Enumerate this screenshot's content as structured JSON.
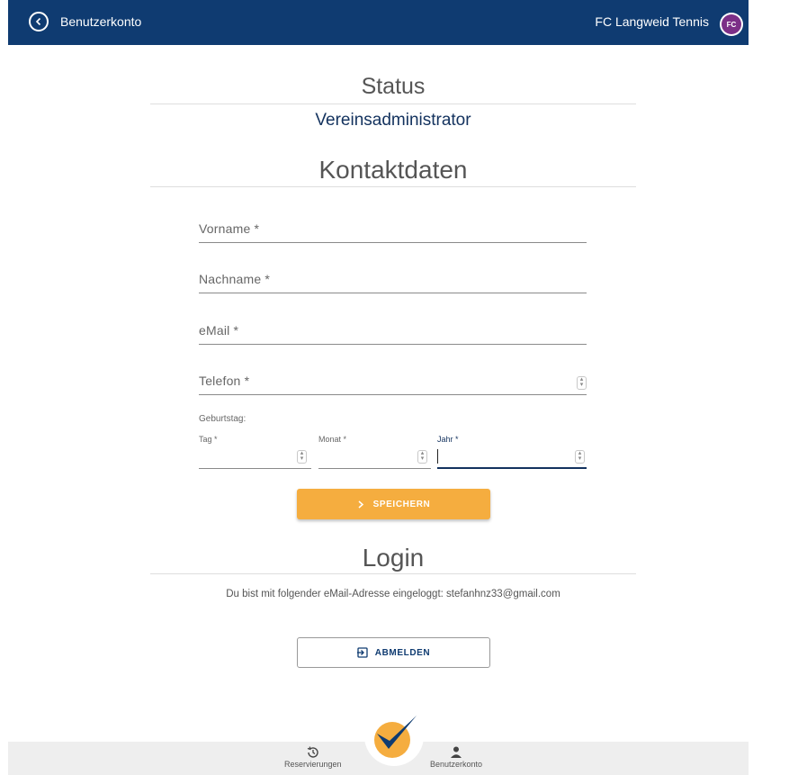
{
  "header": {
    "title": "Benutzerkonto",
    "club_name": "FC Langweid Tennis",
    "logo_text": "FC"
  },
  "status": {
    "heading": "Status",
    "value": "Vereinsadministrator"
  },
  "contact": {
    "heading": "Kontaktdaten",
    "fields": {
      "first_name": {
        "label": "Vorname *",
        "value": ""
      },
      "last_name": {
        "label": "Nachname *",
        "value": ""
      },
      "email": {
        "label": "eMail *",
        "value": ""
      },
      "phone": {
        "label": "Telefon *",
        "value": ""
      }
    },
    "birthday": {
      "label": "Geburtstag:",
      "day_label": "Tag *",
      "month_label": "Monat *",
      "year_label": "Jahr *"
    },
    "save_label": "SPEICHERN"
  },
  "login": {
    "heading": "Login",
    "info": "Du bist mit folgender eMail-Adresse eingeloggt: stefanhnz33@gmail.com",
    "logout_label": "ABMELDEN"
  },
  "bottom_nav": {
    "reservations_label": "Reservierungen",
    "account_label": "Benutzerkonto"
  },
  "colors": {
    "header": "#0f3b71",
    "accent": "#f5ad3f",
    "active_field": "#13325e"
  }
}
